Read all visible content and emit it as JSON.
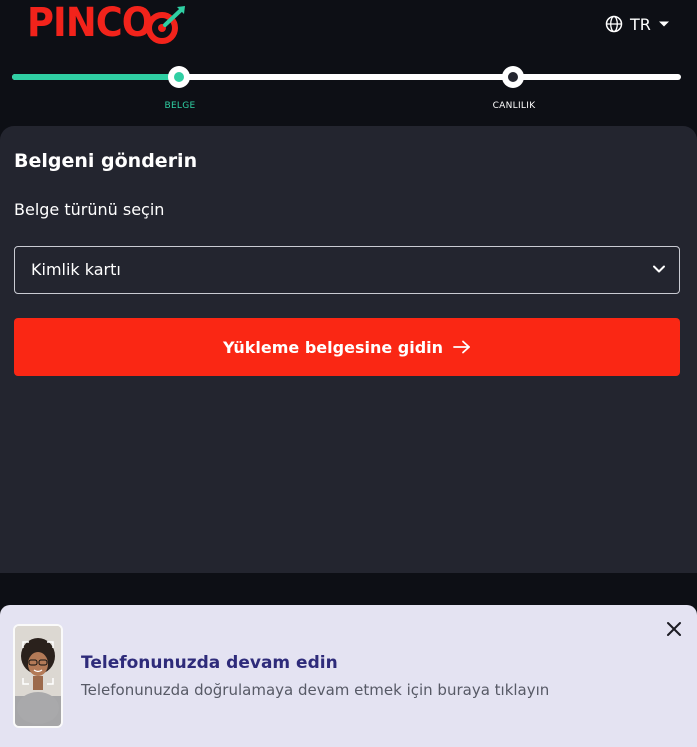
{
  "header": {
    "logo_text": "PINCO",
    "language": "TR",
    "brand_color": "#f2231b"
  },
  "stepper": {
    "progress": 0.25,
    "steps": [
      {
        "label": "BELGE",
        "state": "active",
        "color": "#2fcfa3"
      },
      {
        "label": "CANLILIK",
        "state": "pending",
        "color": "#ffffff"
      }
    ]
  },
  "form": {
    "title": "Belgeni gönderin",
    "document_type_label": "Belge türünü seçin",
    "document_type_value": "Kimlik kartı",
    "submit_label": "Yükleme belgesine gidin",
    "submit_color": "#fa2714"
  },
  "banner": {
    "title": "Telefonunuzda devam edin",
    "subtitle": "Telefonunuzda doğrulamaya devam etmek için buraya tıklayın"
  },
  "icons": {
    "globe": "globe-icon",
    "caret": "caret-down-icon",
    "chevron": "chevron-down-icon",
    "arrow": "arrow-right-icon",
    "close": "close-icon"
  }
}
